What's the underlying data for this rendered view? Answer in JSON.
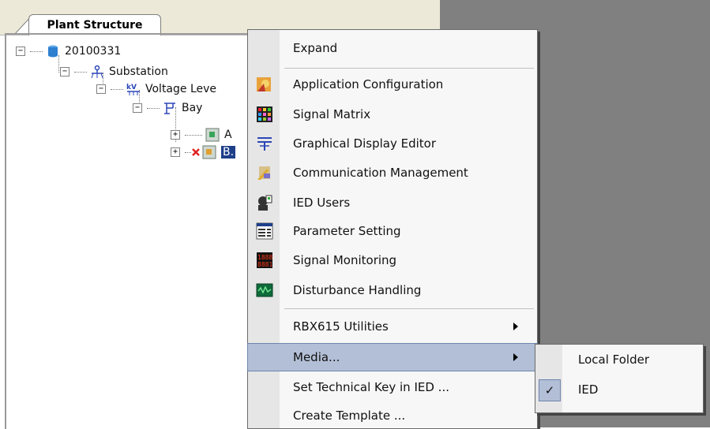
{
  "panel": {
    "tab_label": "Plant Structure"
  },
  "tree": {
    "root": "20100331",
    "substation": "Substation",
    "voltage_level": "Voltage Leve",
    "bay": "Bay",
    "ied_a_label": "A",
    "ied_b_label": "B."
  },
  "menu": {
    "expand": "Expand",
    "items": [
      {
        "label": "Application Configuration",
        "icon": "application-configuration-icon"
      },
      {
        "label": "Signal Matrix",
        "icon": "signal-matrix-icon"
      },
      {
        "label": "Graphical Display Editor",
        "icon": "graphical-display-editor-icon"
      },
      {
        "label": "Communication Management",
        "icon": "communication-management-icon"
      },
      {
        "label": "IED Users",
        "icon": "ied-users-icon"
      },
      {
        "label": "Parameter Setting",
        "icon": "parameter-setting-icon"
      },
      {
        "label": "Signal Monitoring",
        "icon": "signal-monitoring-icon"
      },
      {
        "label": "Disturbance Handling",
        "icon": "disturbance-handling-icon"
      }
    ],
    "utilities": "RBX615 Utilities",
    "media": "Media...",
    "set_key": "Set Technical Key in IED ...",
    "create_template": "Create Template ..."
  },
  "submenu": {
    "local_folder": "Local Folder",
    "ied": "IED",
    "ied_checked": true
  }
}
